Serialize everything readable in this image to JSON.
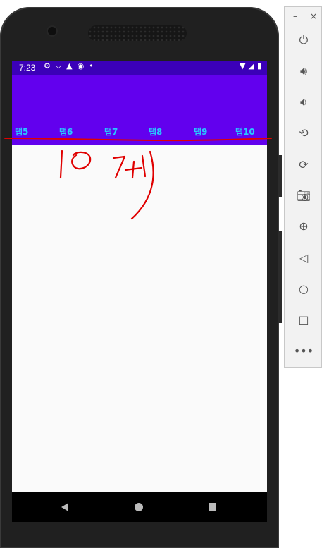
{
  "status_bar": {
    "time": "7:23",
    "dot": "•"
  },
  "tabs": [
    "탭5",
    "탭6",
    "탭7",
    "탭8",
    "탭9",
    "탭10"
  ],
  "annotation": {
    "text": "10개",
    "color": "#e00000"
  },
  "emulator_panel": {
    "minimize": "–",
    "close": "×",
    "buttons": [
      "power-icon",
      "volume-up-icon",
      "volume-down-icon",
      "rotate-left-icon",
      "rotate-right-icon",
      "camera-icon",
      "zoom-icon",
      "back-icon",
      "home-icon",
      "overview-icon",
      "more-icon"
    ]
  },
  "colors": {
    "appbar": "#6200ee",
    "statusbar": "#3b00b8",
    "tab_text": "#27c9ff"
  }
}
